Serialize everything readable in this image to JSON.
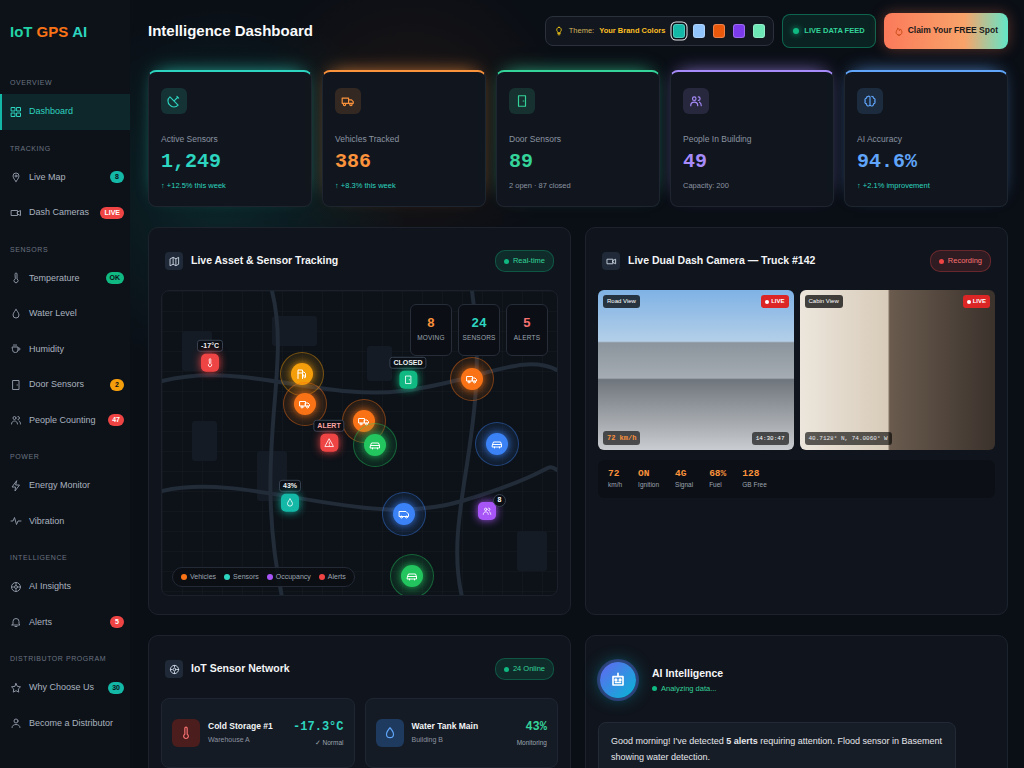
{
  "logo": [
    {
      "text": "IoT",
      "color": "#22d3a6"
    },
    {
      "text": "GPS",
      "color": "#f97316"
    },
    {
      "text": "AI",
      "color": "#2dd4bf"
    }
  ],
  "sidebar": {
    "sections": [
      {
        "title": "OVERVIEW",
        "items": [
          {
            "label": "Dashboard",
            "selected": true
          }
        ]
      },
      {
        "title": "TRACKING",
        "items": [
          {
            "label": "Live Map",
            "selected": false,
            "badge": {
              "text": "8",
              "color": "#14b8a6"
            }
          },
          {
            "label": "Dash Cameras",
            "selected": false,
            "badge": {
              "text": "LIVE",
              "color": "#ef4444"
            }
          }
        ]
      },
      {
        "title": "SENSORS",
        "items": [
          {
            "label": "Temperature",
            "selected": false,
            "badge": {
              "text": "OK",
              "color": "#10b981"
            }
          },
          {
            "label": "Water Level",
            "selected": false
          },
          {
            "label": "Humidity",
            "selected": false
          },
          {
            "label": "Door Sensors",
            "selected": false,
            "badge": {
              "text": "2",
              "color": "#f59e0b"
            }
          },
          {
            "label": "People Counting",
            "selected": false,
            "badge": {
              "text": "47",
              "color": "#ef4444"
            }
          }
        ]
      },
      {
        "title": "POWER",
        "items": [
          {
            "label": "Energy Monitor",
            "selected": false
          },
          {
            "label": "Vibration",
            "selected": false
          }
        ]
      },
      {
        "title": "INTELLIGENCE",
        "items": [
          {
            "label": "AI Insights",
            "selected": false
          },
          {
            "label": "Alerts",
            "selected": false,
            "badge": {
              "text": "5",
              "color": "#ef4444"
            }
          }
        ]
      },
      {
        "title": "DISTRIBUTOR PROGRAM",
        "items": [
          {
            "label": "Why Choose Us",
            "selected": false,
            "badge": {
              "text": "30",
              "color": "#14b8a6"
            }
          },
          {
            "label": "Become a Distributor",
            "selected": false
          }
        ]
      }
    ]
  },
  "header": {
    "title": "Intelligence Dashboard",
    "theme_label": "Theme:",
    "theme_value": "Your Brand Colors",
    "swatches": [
      {
        "color": "#14b8a6",
        "selected": true
      },
      {
        "color": "#93c5fd",
        "selected": false
      },
      {
        "color": "#ea580c",
        "selected": false
      },
      {
        "color": "#7c3aed",
        "selected": false
      },
      {
        "color": "#6ee7b7",
        "selected": false
      }
    ],
    "live": "LIVE DATA FEED",
    "cta": "Claim Your FREE Spot"
  },
  "stats": [
    {
      "label": "Active Sensors",
      "value": "1,249",
      "note": "↑ +12.5% this week",
      "positive": true,
      "color": "#2dd4bf"
    },
    {
      "label": "Vehicles Tracked",
      "value": "386",
      "note": "↑ +8.3% this week",
      "positive": true,
      "color": "#fb923c"
    },
    {
      "label": "Door Sensors",
      "value": "89",
      "note": "2 open · 87 closed",
      "positive": false,
      "color": "#34d399"
    },
    {
      "label": "People In Building",
      "value": "49",
      "note": "Capacity: 200",
      "positive": false,
      "color": "#a78bfa"
    },
    {
      "label": "AI Accuracy",
      "value": "94.6%",
      "note": "↑ +2.1% improvement",
      "positive": true,
      "color": "#60a5fa"
    }
  ],
  "map": {
    "title": "Live Asset & Sensor Tracking",
    "badge": "Real-time",
    "counters": [
      {
        "value": "8",
        "label": "MOVING",
        "color": "#fb923c"
      },
      {
        "value": "24",
        "label": "SENSORS",
        "color": "#2dd4bf"
      },
      {
        "value": "5",
        "label": "ALERTS",
        "color": "#f87171"
      }
    ],
    "markers": [
      {
        "kind": "sensor",
        "label": "-17°C",
        "color": "#ef4444"
      },
      {
        "kind": "vehicle",
        "color": "#f59e0b"
      },
      {
        "kind": "vehicle",
        "color": "#f97316"
      },
      {
        "kind": "alert",
        "label": "ALERT",
        "color": "#ef4444"
      },
      {
        "kind": "vehicle",
        "color": "#f97316"
      },
      {
        "kind": "vehicle",
        "color": "#22c55e"
      },
      {
        "kind": "sensor",
        "label": "CLOSED",
        "color": "#10b981"
      },
      {
        "kind": "vehicle",
        "color": "#f97316"
      },
      {
        "kind": "vehicle",
        "color": "#3b82f6"
      },
      {
        "kind": "sensor",
        "label": "43%",
        "color": "#14b8a6"
      },
      {
        "kind": "vehicle",
        "color": "#3b82f6"
      },
      {
        "kind": "occupancy",
        "label": "8",
        "color": "#a855f7"
      },
      {
        "kind": "vehicle",
        "color": "#22c55e"
      }
    ],
    "legend": [
      {
        "label": "Vehicles",
        "color": "#f97316"
      },
      {
        "label": "Sensors",
        "color": "#2dd4bf"
      },
      {
        "label": "Occupancy",
        "color": "#a855f7"
      },
      {
        "label": "Alerts",
        "color": "#ef4444"
      }
    ]
  },
  "camera": {
    "title": "Live Dual Dash Camera — Truck #142",
    "badge": "Recording",
    "views": [
      {
        "label": "Road View",
        "live": "LIVE",
        "caption": "72 km/h",
        "stamp": "14:30:47"
      },
      {
        "label": "Cabin View",
        "live": "LIVE",
        "caption": "40.7128° N, 74.0060° W"
      }
    ],
    "readings": [
      {
        "value": "72",
        "unit": "km/h"
      },
      {
        "value": "ON",
        "unit": "Ignition"
      },
      {
        "value": "4G",
        "unit": "Signal"
      },
      {
        "value": "68%",
        "unit": "Fuel"
      },
      {
        "value": "128",
        "unit": "GB Free"
      }
    ]
  },
  "sensors": {
    "title": "IoT Sensor Network",
    "badge": "24 Online",
    "items": [
      {
        "name": "Cold Storage #1",
        "location": "Warehouse A",
        "reading": "-17.3°C",
        "status": "✓ Normal",
        "color": "#2dd4bf"
      },
      {
        "name": "Water Tank Main",
        "location": "Building B",
        "reading": "43%",
        "status": "Monitoring",
        "color": "#34d399"
      }
    ]
  },
  "ai": {
    "title": "AI Intelligence",
    "status": "Analyzing data...",
    "message": [
      {
        "text": "Good morning! I've detected ",
        "bold": false
      },
      {
        "text": "5 alerts",
        "bold": true
      },
      {
        "text": " requiring attention. Flood sensor in Basement showing water detection.",
        "bold": false
      }
    ]
  }
}
